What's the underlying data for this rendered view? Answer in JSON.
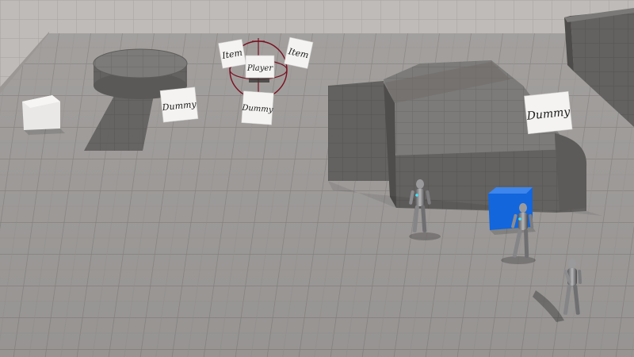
{
  "scene": {
    "labels": {
      "item_left": "Item",
      "item_right": "Item",
      "player": "Player",
      "dummy_left": "Dummy",
      "dummy_center": "Dummy",
      "dummy_right": "Dummy"
    },
    "colors": {
      "floor": "#a9a6a4",
      "grid_line": "#8e8b89",
      "wall": "#bdbab7",
      "dark_block": "#5f5d5b",
      "block_top": "#7b7977",
      "ramp": "#6b6967",
      "blue_cube": "#1363d8",
      "white_cube": "#ecebea",
      "gizmo": "#7a1020",
      "sign_bg": "#f4f3f1"
    },
    "icons": {
      "character": "mannequin-icon",
      "cube": "cube-icon",
      "gizmo": "transform-gizmo-icon"
    }
  }
}
